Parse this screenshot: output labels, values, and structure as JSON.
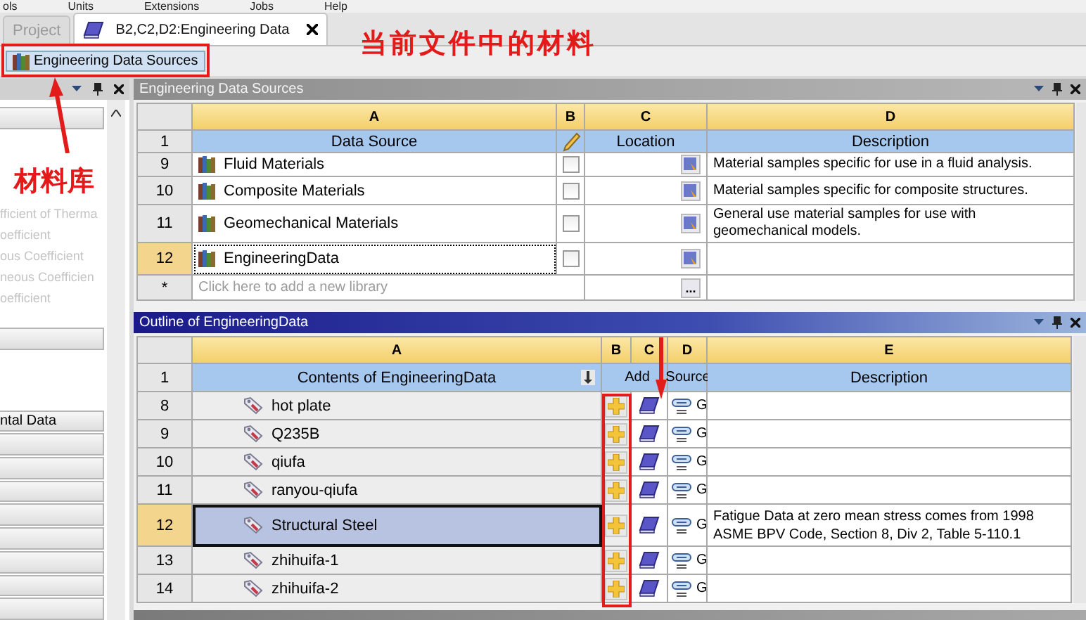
{
  "menu_bar": [
    "ols",
    "Units",
    "Extensions",
    "Jobs",
    "Help"
  ],
  "tabs": [
    {
      "label": "Project",
      "selected": false
    },
    {
      "label": "B2,C2,D2:Engineering Data",
      "selected": true
    }
  ],
  "toolbar": {
    "button": "Engineering Data Sources"
  },
  "left_panel": {
    "items": [
      "fficient of Therma",
      "oefficient",
      "ous Coefficient",
      "neous Coefficien",
      "oefficient"
    ],
    "button": "ntal Data"
  },
  "sources_panel": {
    "title": "Engineering Data Sources",
    "columns": [
      "A",
      "B",
      "C",
      "D"
    ],
    "header": {
      "row": "1",
      "a": "Data Source",
      "c": "Location",
      "d": "Description"
    },
    "rows": [
      {
        "num": "9",
        "name": "Fluid Materials",
        "checked": false,
        "selected": false,
        "description": "Material samples specific for use in a fluid analysis."
      },
      {
        "num": "10",
        "name": "Composite Materials",
        "checked": false,
        "selected": false,
        "description": "Material samples specific for composite structures."
      },
      {
        "num": "11",
        "name": "Geomechanical Materials",
        "checked": false,
        "selected": false,
        "description": "General use material samples for use with geomechanical models."
      },
      {
        "num": "12",
        "name": "EngineeringData",
        "checked": false,
        "selected": true
      }
    ],
    "new_row": {
      "num": "*",
      "placeholder": "Click here to add a new library",
      "browse": "..."
    }
  },
  "outline_panel": {
    "title": "Outline of EngineeringData",
    "columns": [
      "A",
      "B",
      "C",
      "D",
      "E"
    ],
    "header": {
      "row": "1",
      "a": "Contents of EngineeringData",
      "b": "Add",
      "d": "Source",
      "e": "Description"
    },
    "rows": [
      {
        "num": "8",
        "name": "hot plate",
        "source": "G",
        "selected": false
      },
      {
        "num": "9",
        "name": "Q235B",
        "source": "G",
        "selected": false
      },
      {
        "num": "10",
        "name": "qiufa",
        "source": "G",
        "selected": false
      },
      {
        "num": "11",
        "name": "ranyou-qiufa",
        "source": "G",
        "selected": false
      },
      {
        "num": "12",
        "name": "Structural Steel",
        "source": "G",
        "selected": true,
        "description": "Fatigue Data at zero mean stress comes from 1998 ASME BPV Code, Section 8, Div 2, Table 5-110.1"
      },
      {
        "num": "13",
        "name": "zhihuifa-1",
        "source": "G",
        "selected": false
      },
      {
        "num": "14",
        "name": "zhihuifa-2",
        "source": "G",
        "selected": false
      }
    ]
  },
  "annotations": [
    {
      "text": "当前文件中的材料"
    },
    {
      "text": "材料库"
    }
  ]
}
